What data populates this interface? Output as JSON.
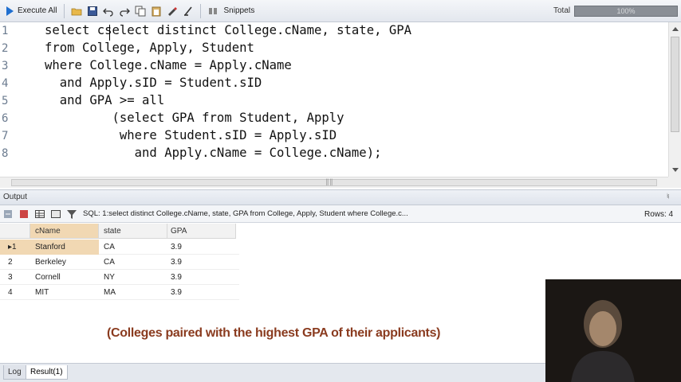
{
  "toolbar": {
    "execute_label": "Execute All",
    "snippets_label": "Snippets",
    "total_label": "Total",
    "total_value": "100%",
    "icons": [
      "play-icon",
      "open-folder-icon",
      "save-icon",
      "undo-icon",
      "redo-icon",
      "copy-icon",
      "paste-icon",
      "format-icon",
      "clear-icon",
      "snippets-icon"
    ]
  },
  "editor": {
    "line_numbers": [
      "1",
      "2",
      "3",
      "4",
      "5",
      "6",
      "7",
      "8"
    ],
    "lines": [
      "select cselect distinct College.cName, state, GPA",
      "from College, Apply, Student",
      "where College.cName = Apply.cName",
      "  and Apply.sID = Student.sID",
      "  and GPA >= all",
      "         (select GPA from Student, Apply",
      "          where Student.sID = Apply.sID",
      "            and Apply.cName = College.cName);"
    ]
  },
  "output": {
    "title": "Output",
    "sql_text": "SQL: 1:select distinct College.cName, state, GPA  from College, Apply, Student  where College.c...",
    "rows_label": "Rows: 4"
  },
  "grid": {
    "columns": [
      "cName",
      "state",
      "GPA"
    ],
    "rows": [
      {
        "num": "1",
        "cName": "Stanford",
        "state": "CA",
        "GPA": "3.9"
      },
      {
        "num": "2",
        "cName": "Berkeley",
        "state": "CA",
        "GPA": "3.9"
      },
      {
        "num": "3",
        "cName": "Cornell",
        "state": "NY",
        "GPA": "3.9"
      },
      {
        "num": "4",
        "cName": "MIT",
        "state": "MA",
        "GPA": "3.9"
      }
    ],
    "selected_row": 0
  },
  "caption": "(Colleges paired with the highest GPA of their applicants)",
  "tabs": {
    "log": "Log",
    "result": "Result(1)"
  },
  "colors": {
    "caption": "#8a3b1f",
    "selection": "#f1d8b3"
  }
}
